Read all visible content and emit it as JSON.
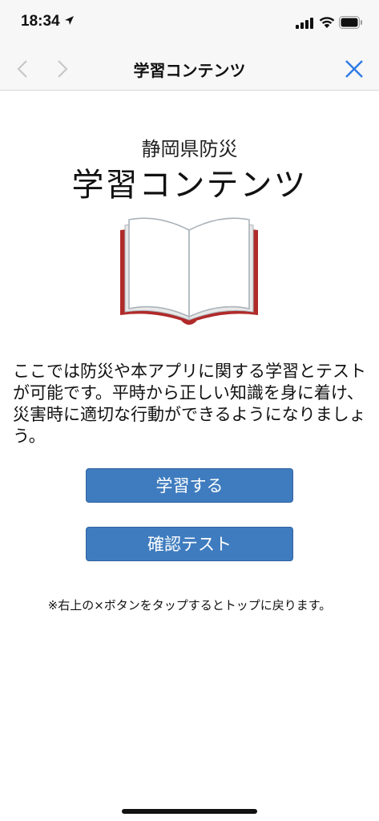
{
  "status": {
    "time": "18:34",
    "icons": [
      "location-arrow-icon",
      "cellular-signal-icon",
      "wifi-icon",
      "battery-icon"
    ]
  },
  "nav": {
    "title": "学習コンテンツ",
    "back_icon": "chevron-left-icon",
    "forward_icon": "chevron-right-icon",
    "close_icon": "close-icon"
  },
  "hero": {
    "subtitle": "静岡県防災",
    "title": "学習コンテンツ",
    "image_icon": "open-book-icon"
  },
  "description": "ここでは防災や本アプリに関する学習とテストが可能です。平時から正しい知識を身に着け、災害時に適切な行動ができるようになりましょう。",
  "buttons": {
    "study": "学習する",
    "test": "確認テスト"
  },
  "note": "※右上の×ボタンをタップするとトップに戻ります。",
  "colors": {
    "accent": "#3f7cbf",
    "close_icon": "#2f7ae5",
    "book_cover": "#b12a2a",
    "nav_disabled": "#c8c8c8"
  }
}
